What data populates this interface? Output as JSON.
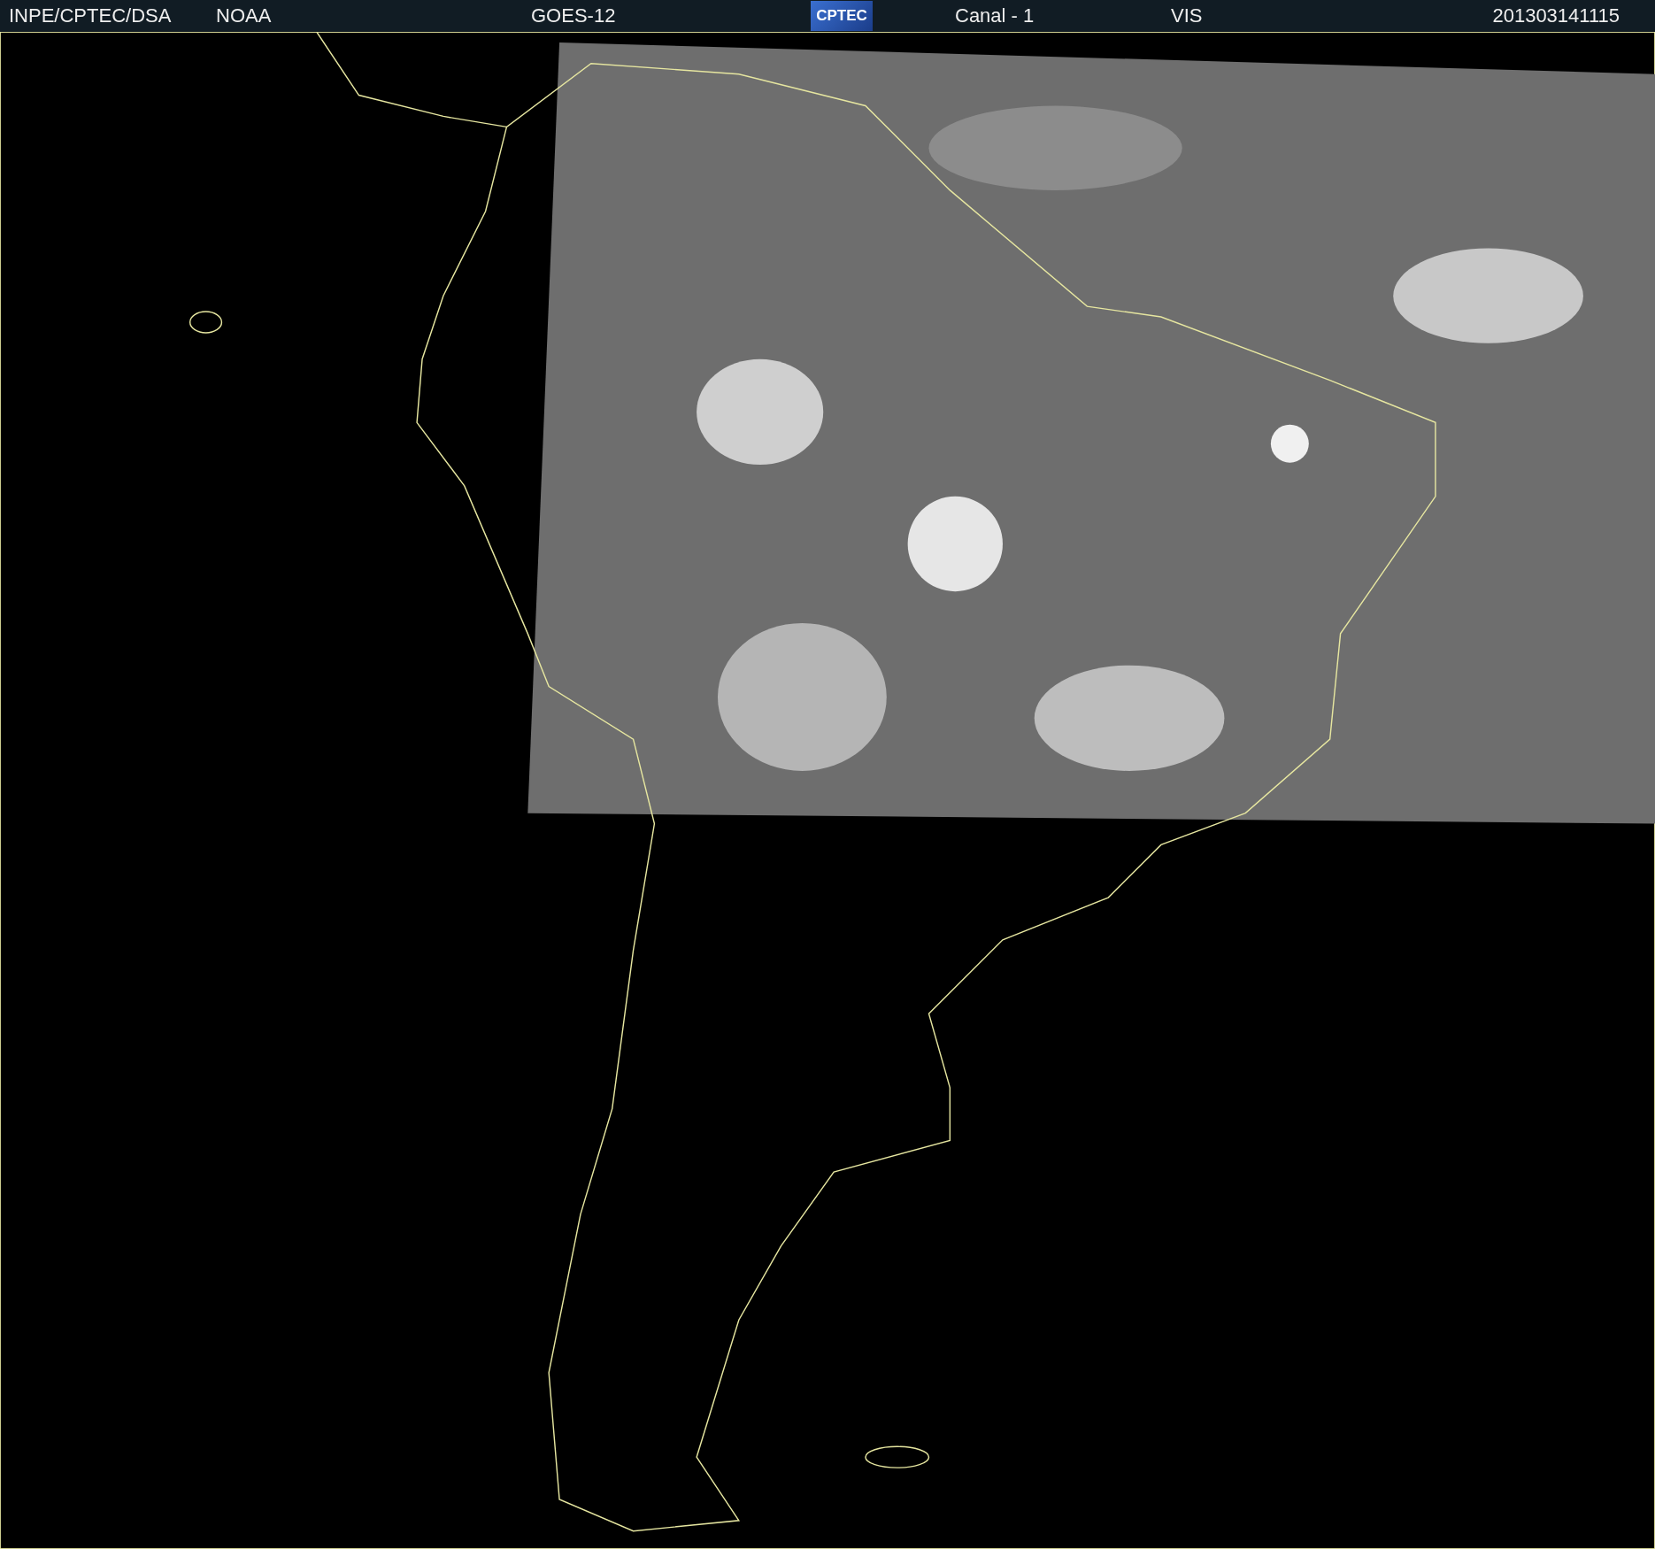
{
  "header": {
    "source": "INPE/CPTEC/DSA",
    "agency": "NOAA",
    "satellite": "GOES-12",
    "logo": "CPTEC",
    "channel": "Canal - 1",
    "band": "VIS",
    "timestamp": "201303141115"
  }
}
